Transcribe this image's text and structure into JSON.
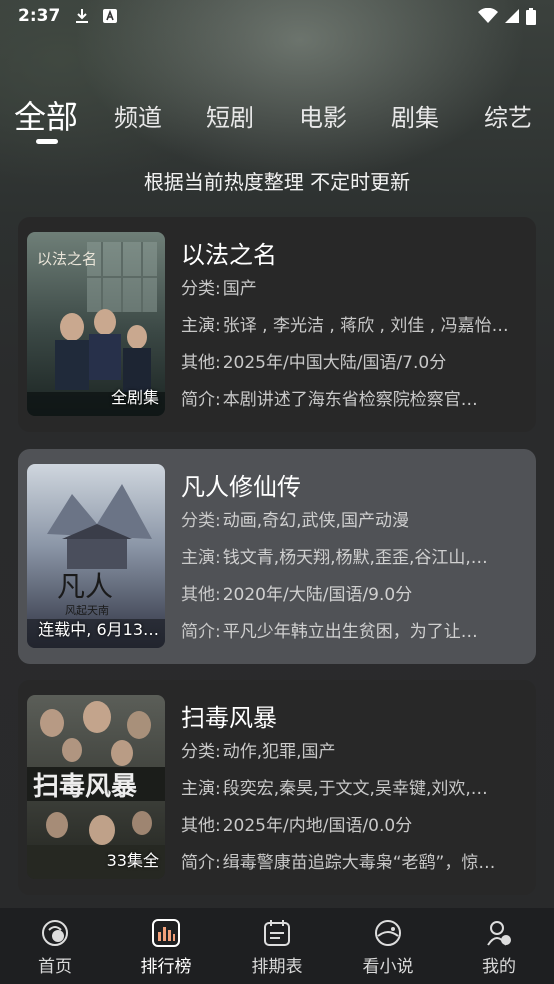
{
  "status_bar": {
    "time": "2:37"
  },
  "tabs": [
    {
      "label": "全部",
      "active": true
    },
    {
      "label": "频道"
    },
    {
      "label": "短剧"
    },
    {
      "label": "电影"
    },
    {
      "label": "剧集"
    },
    {
      "label": "综艺"
    }
  ],
  "subtitle": "根据当前热度整理 不定时更新",
  "items": [
    {
      "title": "以法之名",
      "badge": "全剧集",
      "rows": [
        {
          "k": "分类:",
          "v": "国产"
        },
        {
          "k": "主演:",
          "v": "张译 , 李光洁 , 蒋欣 , 刘佳 , 冯嘉怡…"
        },
        {
          "k": "其他:",
          "v": "2025年/中国大陆/国语/7.0分"
        },
        {
          "k": "简介:",
          "v": "本剧讲述了海东省检察院检察官…"
        }
      ]
    },
    {
      "title": "凡人修仙传",
      "badge": "连载中, 6月13…",
      "rows": [
        {
          "k": "分类:",
          "v": "动画,奇幻,武侠,国产动漫"
        },
        {
          "k": "主演:",
          "v": "钱文青,杨天翔,杨默,歪歪,谷江山,…"
        },
        {
          "k": "其他:",
          "v": "2020年/大陆/国语/9.0分"
        },
        {
          "k": "简介:",
          "v": "平凡少年韩立出生贫困，为了让…"
        }
      ]
    },
    {
      "title": "扫毒风暴",
      "badge": "33集全",
      "rows": [
        {
          "k": "分类:",
          "v": "动作,犯罪,国产"
        },
        {
          "k": "主演:",
          "v": "段奕宏,秦昊,于文文,吴幸键,刘欢,…"
        },
        {
          "k": "其他:",
          "v": "2025年/内地/国语/0.0分"
        },
        {
          "k": "简介:",
          "v": "缉毒警康苗追踪大毒枭“老鹞”，惊…"
        }
      ]
    }
  ],
  "bottom_nav": [
    {
      "label": "首页",
      "icon": "home-icon"
    },
    {
      "label": "排行榜",
      "icon": "chart-icon",
      "active": true
    },
    {
      "label": "排期表",
      "icon": "calendar-icon"
    },
    {
      "label": "看小说",
      "icon": "book-icon"
    },
    {
      "label": "我的",
      "icon": "profile-icon"
    }
  ]
}
